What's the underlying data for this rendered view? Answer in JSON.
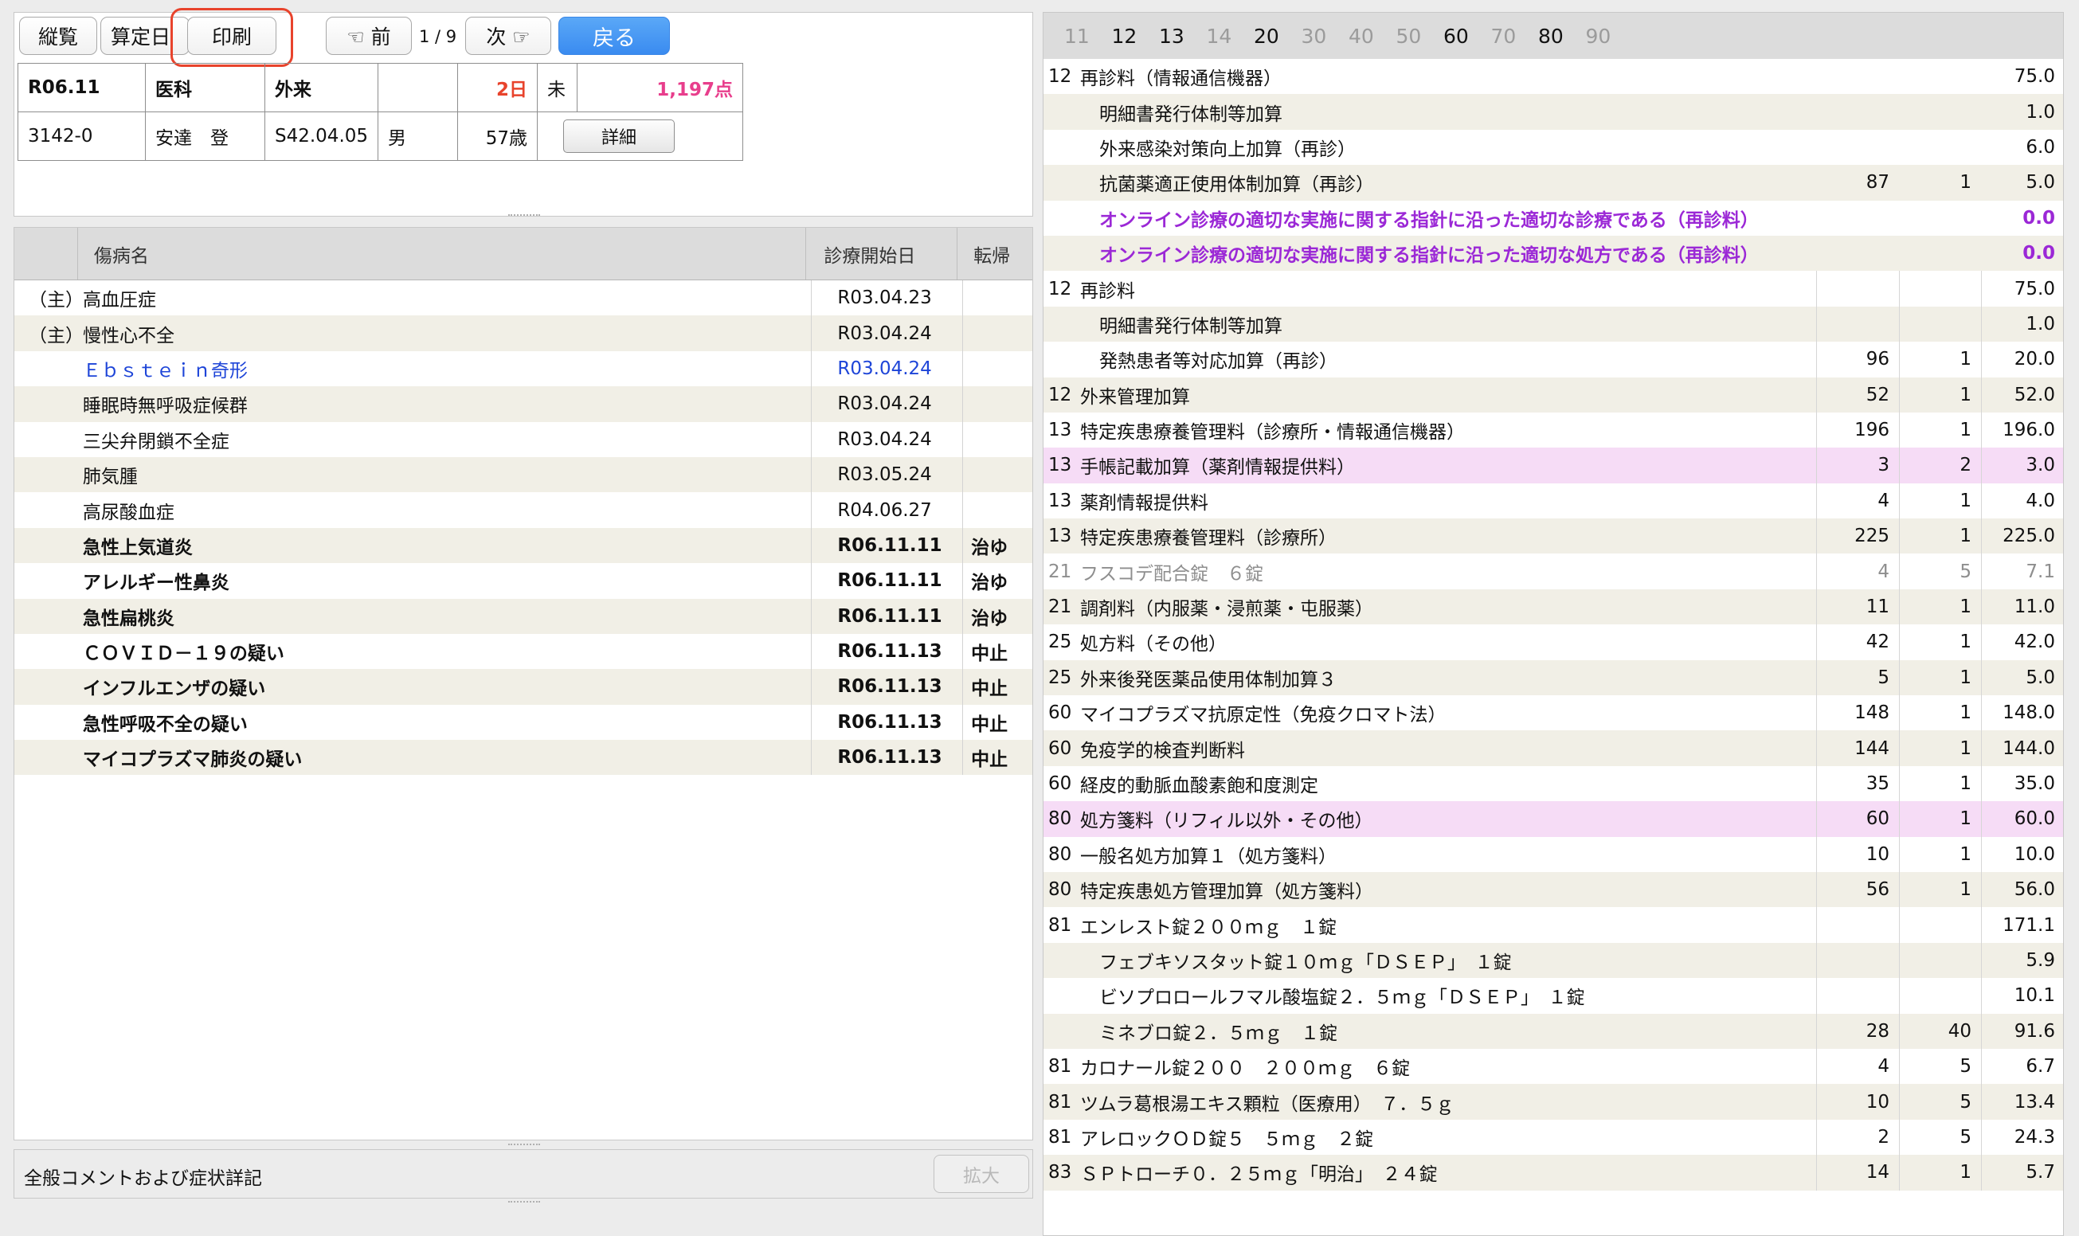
{
  "toolbar": {
    "buttons": [
      "縦覧",
      "算定日",
      "印刷"
    ],
    "prev": "☜ 前",
    "page": "1 / 9",
    "next": "次 ☞",
    "back": "戻る"
  },
  "patient": {
    "month": "R06.11",
    "category": "医科",
    "type": "外来",
    "empty": "",
    "days": "2日",
    "status": "未",
    "points": "1,197点",
    "id": "3142-0",
    "name": "安達　登",
    "birth": "S42.04.05",
    "sex": "男",
    "age": "57歳",
    "detail_button": "詳細"
  },
  "diseases": {
    "headers": [
      "",
      "傷病名",
      "診療開始日",
      "転帰"
    ],
    "rows": [
      {
        "prefix": "（主）",
        "name": "高血圧症",
        "date": "R03.04.23",
        "outcome": ""
      },
      {
        "prefix": "（主）",
        "name": "慢性心不全",
        "date": "R03.04.24",
        "outcome": ""
      },
      {
        "prefix": "",
        "name": "Ｅｂｓｔｅｉｎ奇形",
        "date": "R03.04.24",
        "outcome": ""
      },
      {
        "prefix": "",
        "name": "睡眠時無呼吸症候群",
        "date": "R03.04.24",
        "outcome": ""
      },
      {
        "prefix": "",
        "name": "三尖弁閉鎖不全症",
        "date": "R03.04.24",
        "outcome": ""
      },
      {
        "prefix": "",
        "name": "肺気腫",
        "date": "R03.05.24",
        "outcome": ""
      },
      {
        "prefix": "",
        "name": "高尿酸血症",
        "date": "R04.06.27",
        "outcome": ""
      },
      {
        "prefix": "",
        "name": "急性上気道炎",
        "date": "R06.11.11",
        "outcome": "治ゆ"
      },
      {
        "prefix": "",
        "name": "アレルギー性鼻炎",
        "date": "R06.11.11",
        "outcome": "治ゆ"
      },
      {
        "prefix": "",
        "name": "急性扁桃炎",
        "date": "R06.11.11",
        "outcome": "治ゆ"
      },
      {
        "prefix": "",
        "name": "ＣＯＶＩＤ－１９の疑い",
        "date": "R06.11.13",
        "outcome": "中止"
      },
      {
        "prefix": "",
        "name": "インフルエンザの疑い",
        "date": "R06.11.13",
        "outcome": "中止"
      },
      {
        "prefix": "",
        "name": "急性呼吸不全の疑い",
        "date": "R06.11.13",
        "outcome": "中止"
      },
      {
        "prefix": "",
        "name": "マイコプラズマ肺炎の疑い",
        "date": "R06.11.13",
        "outcome": "中止"
      }
    ]
  },
  "comments": {
    "label": "全般コメントおよび症状詳記",
    "expand_button": "拡大"
  },
  "tabs": [
    "11",
    "12",
    "13",
    "14",
    "20",
    "30",
    "40",
    "50",
    "60",
    "70",
    "80",
    "90"
  ],
  "procedures": [
    {
      "code": "12",
      "name": "再診料（情報通信機器）",
      "a": "",
      "q": "",
      "t": "75.0"
    },
    {
      "code": "",
      "name": "明細書発行体制等加算",
      "a": "",
      "q": "",
      "t": "1.0"
    },
    {
      "code": "",
      "name": "外来感染対策向上加算（再診）",
      "a": "",
      "q": "",
      "t": "6.0"
    },
    {
      "code": "",
      "name": "抗菌薬適正使用体制加算（再診）",
      "a": "87",
      "q": "1",
      "t": "5.0"
    },
    {
      "code": "",
      "name": "オンライン診療の適切な実施に関する指針に沿った適切な診療である（再診料）",
      "a": "",
      "q": "",
      "t": "0.0"
    },
    {
      "code": "",
      "name": "オンライン診療の適切な実施に関する指針に沿った適切な処方である（再診料）",
      "a": "",
      "q": "",
      "t": "0.0"
    },
    {
      "code": "12",
      "name": "再診料",
      "a": "",
      "q": "",
      "t": "75.0"
    },
    {
      "code": "",
      "name": "明細書発行体制等加算",
      "a": "",
      "q": "",
      "t": "1.0"
    },
    {
      "code": "",
      "name": "発熱患者等対応加算（再診）",
      "a": "96",
      "q": "1",
      "t": "20.0"
    },
    {
      "code": "12",
      "name": "外来管理加算",
      "a": "52",
      "q": "1",
      "t": "52.0"
    },
    {
      "code": "13",
      "name": "特定疾患療養管理料（診療所・情報通信機器）",
      "a": "196",
      "q": "1",
      "t": "196.0"
    },
    {
      "code": "13",
      "name": "手帳記載加算（薬剤情報提供料）",
      "a": "3",
      "q": "2",
      "t": "3.0"
    },
    {
      "code": "13",
      "name": "薬剤情報提供料",
      "a": "4",
      "q": "1",
      "t": "4.0"
    },
    {
      "code": "13",
      "name": "特定疾患療養管理料（診療所）",
      "a": "225",
      "q": "1",
      "t": "225.0"
    },
    {
      "code": "21",
      "name": "フスコデ配合錠　６錠",
      "a": "4",
      "q": "5",
      "t": "7.1"
    },
    {
      "code": "21",
      "name": "調剤料（内服薬・浸煎薬・屯服薬）",
      "a": "11",
      "q": "1",
      "t": "11.0"
    },
    {
      "code": "25",
      "name": "処方料（その他）",
      "a": "42",
      "q": "1",
      "t": "42.0"
    },
    {
      "code": "25",
      "name": "外来後発医薬品使用体制加算３",
      "a": "5",
      "q": "1",
      "t": "5.0"
    },
    {
      "code": "60",
      "name": "マイコプラズマ抗原定性（免疫クロマト法）",
      "a": "148",
      "q": "1",
      "t": "148.0"
    },
    {
      "code": "60",
      "name": "免疫学的検査判断料",
      "a": "144",
      "q": "1",
      "t": "144.0"
    },
    {
      "code": "60",
      "name": "経皮的動脈血酸素飽和度測定",
      "a": "35",
      "q": "1",
      "t": "35.0"
    },
    {
      "code": "80",
      "name": "処方箋料（リフィル以外・その他）",
      "a": "60",
      "q": "1",
      "t": "60.0"
    },
    {
      "code": "80",
      "name": "一般名処方加算１（処方箋料）",
      "a": "10",
      "q": "1",
      "t": "10.0"
    },
    {
      "code": "80",
      "name": "特定疾患処方管理加算（処方箋料）",
      "a": "56",
      "q": "1",
      "t": "56.0"
    },
    {
      "code": "81",
      "name": "エンレスト錠２００ｍｇ　１錠",
      "a": "",
      "q": "",
      "t": "171.1"
    },
    {
      "code": "",
      "name": "フェブキソスタット錠１０ｍｇ「ＤＳＥＰ」　１錠",
      "a": "",
      "q": "",
      "t": "5.9"
    },
    {
      "code": "",
      "name": "ビソプロロールフマル酸塩錠２．５ｍｇ「ＤＳＥＰ」　１錠",
      "a": "",
      "q": "",
      "t": "10.1"
    },
    {
      "code": "",
      "name": "ミネブロ錠２．５ｍｇ　１錠",
      "a": "28",
      "q": "40",
      "t": "91.6"
    },
    {
      "code": "81",
      "name": "カロナール錠２００　２００ｍｇ　６錠",
      "a": "4",
      "q": "5",
      "t": "6.7"
    },
    {
      "code": "81",
      "name": "ツムラ葛根湯エキス顆粒（医療用）　７．５ｇ",
      "a": "10",
      "q": "5",
      "t": "13.4"
    },
    {
      "code": "81",
      "name": "アレロックＯＤ錠５　５ｍｇ　２錠",
      "a": "2",
      "q": "5",
      "t": "24.3"
    },
    {
      "code": "83",
      "name": "ＳＰトローチ０．２５ｍｇ「明治」　２４錠",
      "a": "14",
      "q": "1",
      "t": "5.7"
    }
  ]
}
